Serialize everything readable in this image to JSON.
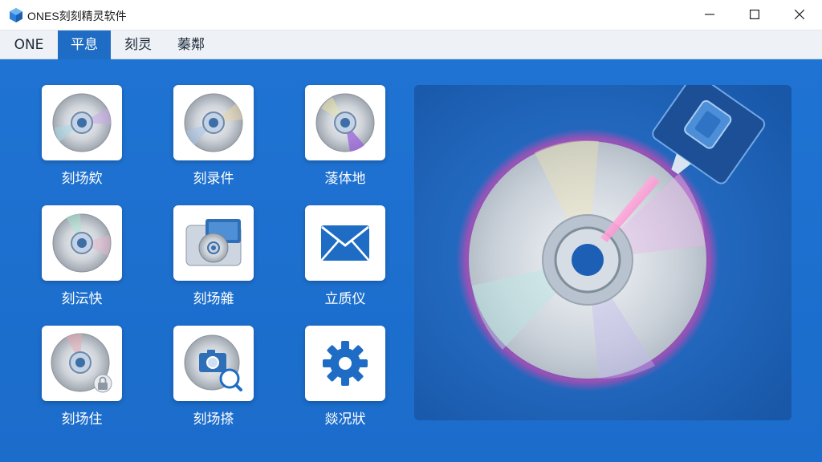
{
  "window": {
    "title": "ONES刻刻精灵软件",
    "icon": "app-cube-icon",
    "controls": [
      "minimize-icon",
      "maximize-icon",
      "close-icon"
    ]
  },
  "menu": [
    {
      "label": "ONE",
      "active": false
    },
    {
      "label": "平息",
      "active": true
    },
    {
      "label": "刻灵",
      "active": false
    },
    {
      "label": "蓁鄰",
      "active": false
    }
  ],
  "tiles": [
    {
      "label": "刻场欸",
      "icon": "disc-icon"
    },
    {
      "label": "刻录件",
      "icon": "disc-icon"
    },
    {
      "label": "蓤体地",
      "icon": "disc-icon"
    },
    {
      "label": "刻沄快",
      "icon": "disc-icon"
    },
    {
      "label": "刻场雜",
      "icon": "disc-photo-icon"
    },
    {
      "label": "立质仪",
      "icon": "envelope-icon"
    },
    {
      "label": "刻场住",
      "icon": "disc-lock-icon"
    },
    {
      "label": "刻场搽",
      "icon": "photo-search-icon"
    },
    {
      "label": "燚况狀",
      "icon": "gear-icon"
    }
  ],
  "preview": {
    "image": "disc-burning-laser-illustration"
  },
  "colors": {
    "accent": "#1f6cc4",
    "background": "#1e6fd0",
    "laser": "#ff3fae"
  }
}
